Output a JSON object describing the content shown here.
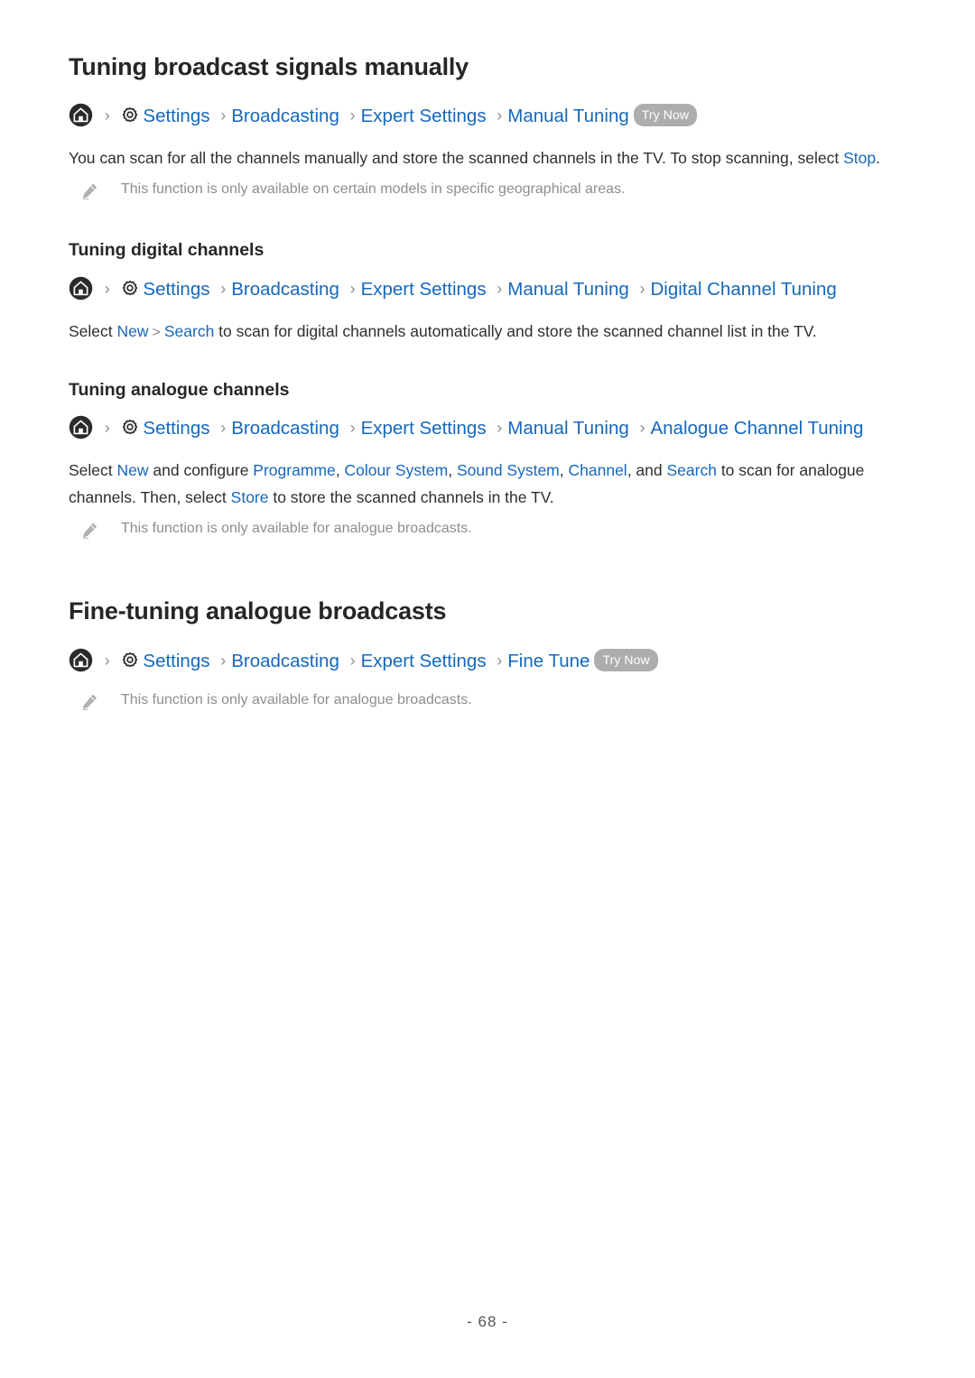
{
  "document": {
    "page_number": "- 68 -"
  },
  "icons": {
    "home": "home-icon",
    "gear": "gear-icon",
    "pencil": "pencil-note-icon",
    "separator": ">"
  },
  "colors": {
    "link_blue": "#1668bb",
    "heading": "#262626",
    "body": "#2e2e2e",
    "note_grey": "#8e8e8e",
    "badge_grey": "#adadad",
    "separator_grey": "#8d8d8d"
  },
  "sections": [
    {
      "id": "tuning-broadcast-signals-manually",
      "title": "Tuning broadcast signals manually",
      "breadcrumb": {
        "crumbs": [
          "Settings",
          "Broadcasting",
          "Expert Settings",
          "Manual Tuning"
        ],
        "badge": "Try Now"
      },
      "paragraph": {
        "part1": "You can scan for all the channels manually and store the scanned channels in the TV. To stop scanning, select ",
        "link1": "Stop",
        "part2": "."
      },
      "note": "This function is only available on certain models in specific geographical areas."
    },
    {
      "id": "tuning-digital-channels",
      "subtitle": "Tuning digital channels",
      "breadcrumb": {
        "crumbs": [
          "Settings",
          "Broadcasting",
          "Expert Settings",
          "Manual Tuning",
          "Digital Channel Tuning"
        ]
      },
      "paragraph": {
        "part1": "Select ",
        "link1": "New",
        "sep": ">",
        "link2": "Search",
        "part2": " to scan for digital channels automatically and store the scanned channel list in the TV."
      }
    },
    {
      "id": "tuning-analogue-channels",
      "subtitle": "Tuning analogue channels",
      "breadcrumb": {
        "crumbs": [
          "Settings",
          "Broadcasting",
          "Expert Settings",
          "Manual Tuning",
          "Analogue Channel Tuning"
        ]
      },
      "paragraph": {
        "part1": "Select ",
        "link1": "New",
        "part2": " and configure ",
        "link2": "Programme",
        "part3": ", ",
        "link3": "Colour System",
        "part4": ", ",
        "link4": "Sound System",
        "part5": ", ",
        "link5": "Channel",
        "part6": ", and ",
        "link6": "Search",
        "part7": " to scan for analogue channels. Then, select ",
        "link7": "Store",
        "part8": " to store the scanned channels in the TV."
      },
      "note": "This function is only available for analogue broadcasts."
    },
    {
      "id": "fine-tuning-analogue-broadcasts",
      "title": "Fine-tuning analogue broadcasts",
      "breadcrumb": {
        "crumbs": [
          "Settings",
          "Broadcasting",
          "Expert Settings",
          "Fine Tune"
        ],
        "badge": "Try Now"
      },
      "note": "This function is only available for analogue broadcasts."
    }
  ]
}
